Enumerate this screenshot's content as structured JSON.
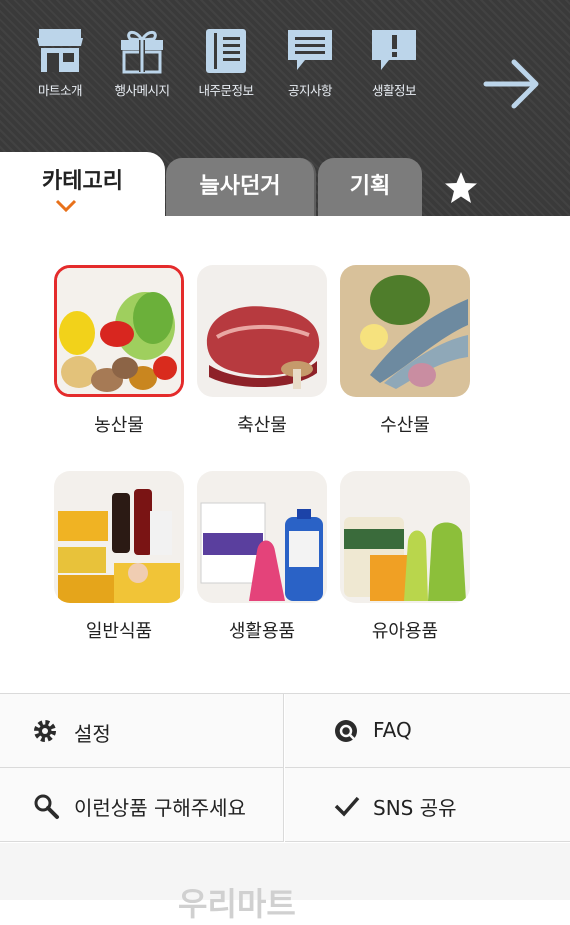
{
  "nav": [
    {
      "label": "마트소개",
      "icon": "store-icon"
    },
    {
      "label": "행사메시지",
      "icon": "gift-icon"
    },
    {
      "label": "내주문정보",
      "icon": "order-book-icon"
    },
    {
      "label": "공지사항",
      "icon": "notice-icon"
    },
    {
      "label": "생활정보",
      "icon": "info-icon"
    }
  ],
  "tabs": {
    "category": "카테고리",
    "sale": "늘사던거",
    "plan": "기획"
  },
  "categories": [
    {
      "label": "농산물"
    },
    {
      "label": "축산물"
    },
    {
      "label": "수산물"
    },
    {
      "label": "일반식품"
    },
    {
      "label": "생활용품"
    },
    {
      "label": "유아용품"
    }
  ],
  "menu": {
    "settings": "설정",
    "faq": "FAQ",
    "request": "이런상품 구해주세요",
    "sns": "SNS 공유"
  },
  "footer": {
    "logo": "우리마트"
  },
  "colors": {
    "accent": "#e8711a",
    "selected_border": "#e42b2b",
    "icon": "#bcd5ea"
  }
}
